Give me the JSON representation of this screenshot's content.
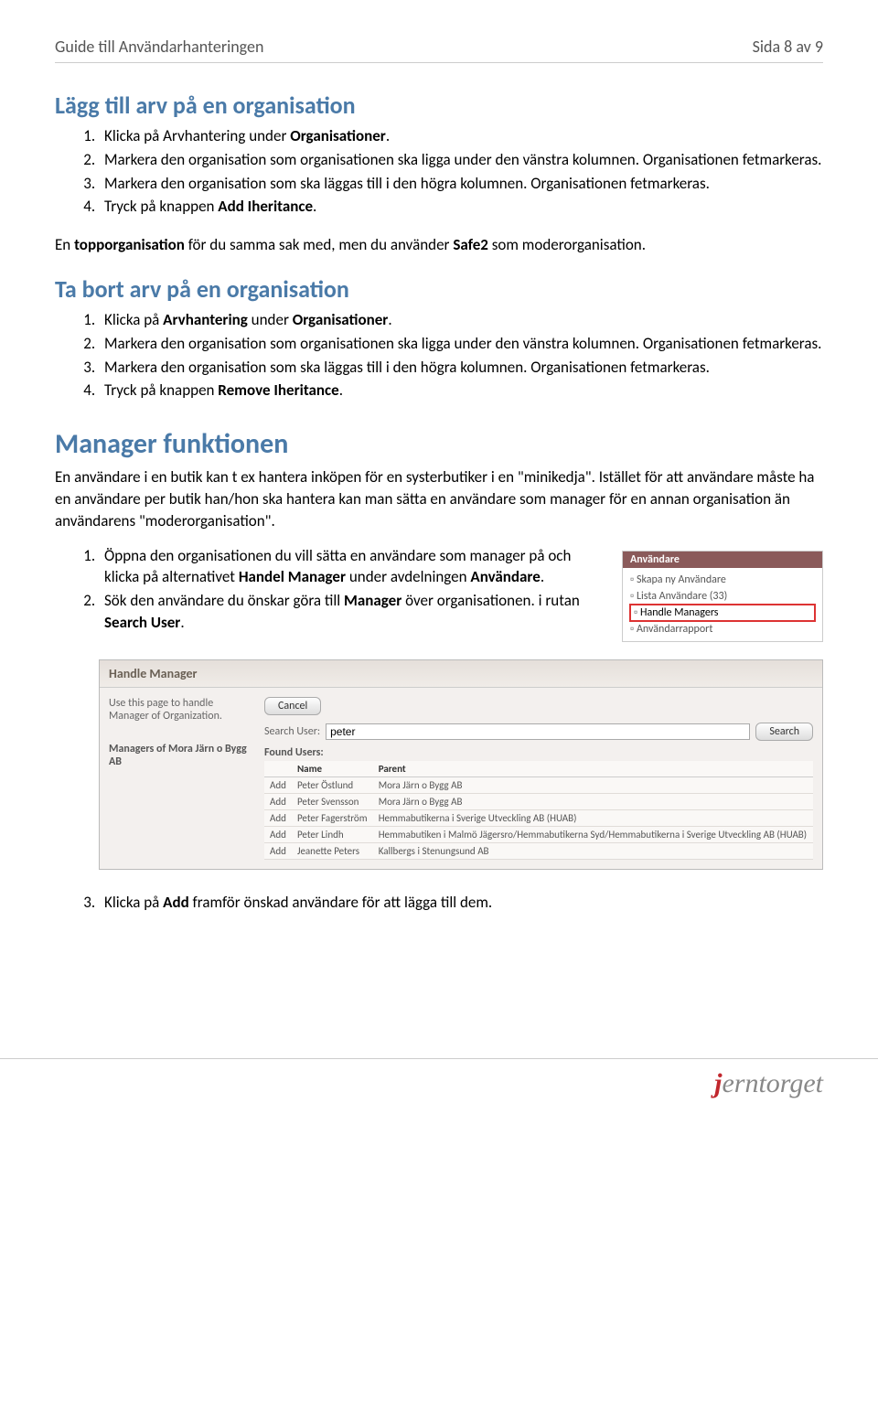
{
  "header": {
    "title": "Guide till Användarhanteringen",
    "page": "Sida 8 av 9"
  },
  "sec1": {
    "heading": "Lägg till arv på en organisation",
    "steps": [
      {
        "pre": "Klicka på Arvhantering under ",
        "b": "Organisationer",
        "post": "."
      },
      {
        "pre": "Markera den organisation som organisationen ska ligga under den vänstra kolumnen. Organisationen fetmarkeras.",
        "b": "",
        "post": ""
      },
      {
        "pre": "Markera den organisation som ska läggas till i den högra kolumnen. Organisationen fetmarkeras.",
        "b": "",
        "post": ""
      },
      {
        "pre": "Tryck på knappen ",
        "b": "Add Iheritance",
        "post": "."
      }
    ],
    "note_pre": "En ",
    "note_b1": "topporganisation",
    "note_mid": " för du samma sak med, men du använder ",
    "note_b2": "Safe2",
    "note_post": " som moderorganisation."
  },
  "sec2": {
    "heading": "Ta bort arv på en organisation",
    "steps": [
      {
        "pre": "Klicka på ",
        "b": "Arvhantering",
        "mid": " under ",
        "b2": "Organisationer",
        "post": "."
      },
      {
        "pre": "Markera den organisation som organisationen ska ligga under den vänstra kolumnen. Organisationen fetmarkeras.",
        "b": "",
        "mid": "",
        "b2": "",
        "post": ""
      },
      {
        "pre": "Markera den organisation som ska läggas till i den högra kolumnen. Organisationen fetmarkeras.",
        "b": "",
        "mid": "",
        "b2": "",
        "post": ""
      },
      {
        "pre": "Tryck på knappen ",
        "b": "Remove Iheritance",
        "mid": "",
        "b2": "",
        "post": "."
      }
    ]
  },
  "sec3": {
    "heading": "Manager funktionen",
    "intro": "En användare i en butik kan t ex hantera inköpen för en systerbutiker i en \"minikedja\". Istället för att användare måste ha en användare per butik han/hon ska hantera kan man sätta en användare som manager för en annan organisation än användarens \"moderorganisation\".",
    "steps": [
      {
        "pre": "Öppna den organisationen du vill sätta en användare som manager på och klicka på alternativet ",
        "b": "Handel Manager",
        "mid": " under avdelningen ",
        "b2": "Användare",
        "post": "."
      },
      {
        "pre": "Sök den användare du önskar göra till ",
        "b": "Manager",
        "mid": " över organisationen. i rutan ",
        "b2": "Search User",
        "post": "."
      }
    ],
    "step3": {
      "pre": "Klicka på ",
      "b": "Add",
      "post": " framför önskad användare för att lägga till dem."
    }
  },
  "sidepanel": {
    "header": "Användare",
    "items": [
      "Skapa ny Användare",
      "Lista Användare (33)",
      "Handle Managers",
      "Användarrapport"
    ]
  },
  "shot": {
    "title": "Handle Manager",
    "desc": "Use this page to handle Manager of Organization.",
    "cancel": "Cancel",
    "managers_of": "Managers of Mora Järn o Bygg AB",
    "search_label": "Search User:",
    "search_value": "peter",
    "search_btn": "Search",
    "found_label": "Found Users:",
    "cols": [
      "",
      "Name",
      "Parent"
    ],
    "rows": [
      {
        "a": "Add",
        "n": "Peter Östlund",
        "p": "Mora Järn o Bygg AB"
      },
      {
        "a": "Add",
        "n": "Peter Svensson",
        "p": "Mora Järn o Bygg AB"
      },
      {
        "a": "Add",
        "n": "Peter Fagerström",
        "p": "Hemmabutikerna i Sverige Utveckling AB (HUAB)"
      },
      {
        "a": "Add",
        "n": "Peter Lindh",
        "p": "Hemmabutiken i Malmö Jägersro/Hemmabutikerna Syd/Hemmabutikerna i Sverige Utveckling AB (HUAB)"
      },
      {
        "a": "Add",
        "n": "Jeanette Peters",
        "p": "Kallbergs i Stenungsund AB"
      }
    ]
  },
  "logo": {
    "j": "j",
    "rest": "erntorget"
  }
}
